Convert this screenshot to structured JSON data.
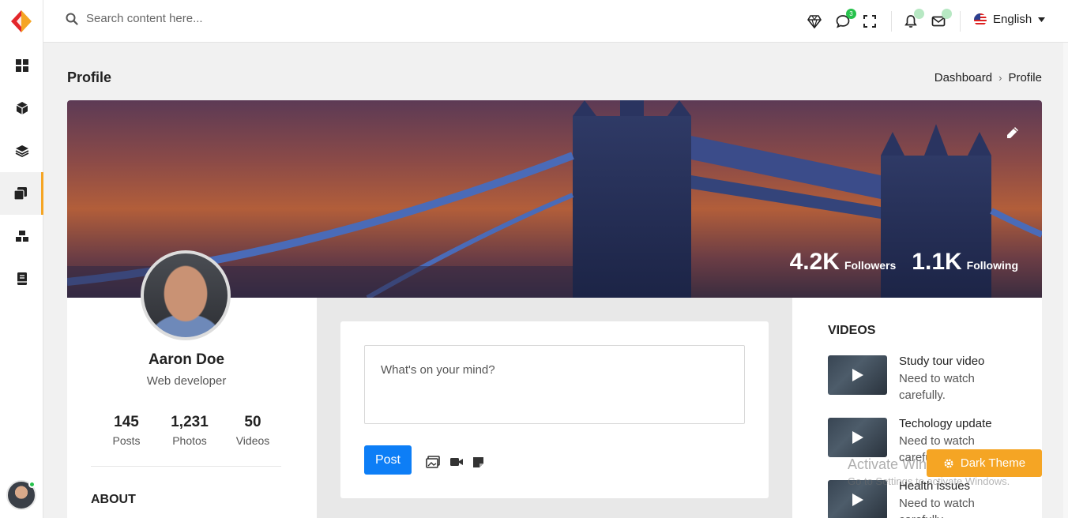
{
  "header": {
    "search_placeholder": "Search content here...",
    "chat_badge": "3",
    "language": "English"
  },
  "page": {
    "title": "Profile",
    "breadcrumb": [
      "Dashboard",
      "Profile"
    ]
  },
  "cover": {
    "followers_count": "4.2K",
    "followers_label": "Followers",
    "following_count": "1.1K",
    "following_label": "Following"
  },
  "profile": {
    "name": "Aaron Doe",
    "role": "Web developer",
    "stats": [
      {
        "value": "145",
        "label": "Posts"
      },
      {
        "value": "1,231",
        "label": "Photos"
      },
      {
        "value": "50",
        "label": "Videos"
      }
    ],
    "about_title": "ABOUT"
  },
  "post": {
    "placeholder": "What's on your mind?",
    "button_label": "Post"
  },
  "videos": {
    "title": "VIDEOS",
    "items": [
      {
        "title": "Study tour video",
        "subtitle": "Need to watch carefully."
      },
      {
        "title": "Techology update",
        "subtitle": "Need to watch carefully."
      },
      {
        "title": "Health issues",
        "subtitle": "Need to watch carefully."
      }
    ]
  },
  "theme_button": "Dark Theme",
  "os_watermark": {
    "line1": "Activate Windows",
    "line2": "Go to Settings to activate Windows."
  },
  "colors": {
    "accent": "#f5a524",
    "primary": "#0d7ef6",
    "online": "#27c24c"
  }
}
